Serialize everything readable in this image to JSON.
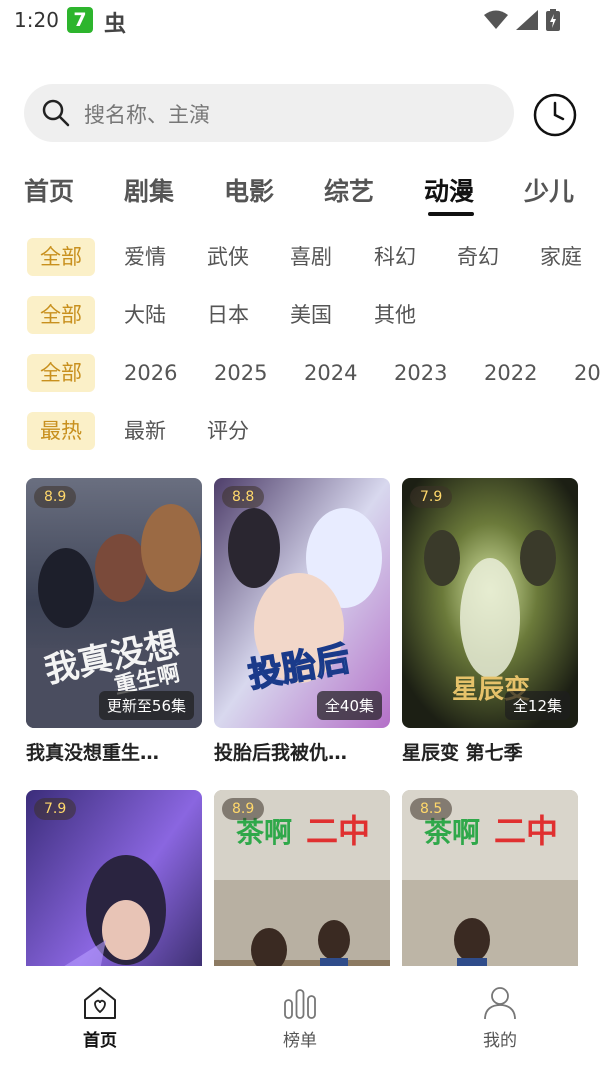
{
  "status": {
    "time": "1:20",
    "app_icon_glyph": "7",
    "app_icon_color": "#2db52d",
    "bug_glyph": "虫"
  },
  "search": {
    "placeholder": "搜名称、主演",
    "icon": "search-icon",
    "history_icon": "clock-icon"
  },
  "tabs": [
    {
      "label": "首页",
      "active": false
    },
    {
      "label": "剧集",
      "active": false
    },
    {
      "label": "电影",
      "active": false
    },
    {
      "label": "综艺",
      "active": false
    },
    {
      "label": "动漫",
      "active": true
    },
    {
      "label": "少儿",
      "active": false
    }
  ],
  "filters": {
    "genre": [
      "全部",
      "爱情",
      "武侠",
      "喜剧",
      "科幻",
      "奇幻",
      "家庭"
    ],
    "region": [
      "全部",
      "大陆",
      "日本",
      "美国",
      "其他"
    ],
    "year": [
      "全部",
      "2026",
      "2025",
      "2024",
      "2023",
      "2022",
      "20"
    ],
    "sort": [
      "最热",
      "最新",
      "评分"
    ]
  },
  "colors": {
    "accent": "#c8901e",
    "chip_bg": "#fbf0c8",
    "rating_text": "#ffd86b"
  },
  "cards": [
    {
      "title": "我真没想重生…",
      "rating": "8.9",
      "episode": "更新至56集"
    },
    {
      "title": "投胎后我被仇…",
      "rating": "8.8",
      "episode": "全40集"
    },
    {
      "title": "星辰变 第七季",
      "rating": "7.9",
      "episode": "全12集"
    },
    {
      "title": "",
      "rating": "7.9",
      "episode": ""
    },
    {
      "title": "",
      "rating": "8.9",
      "episode": ""
    },
    {
      "title": "",
      "rating": "8.5",
      "episode": ""
    }
  ],
  "nav": [
    {
      "label": "首页",
      "icon": "home-icon",
      "active": true
    },
    {
      "label": "榜单",
      "icon": "chart-icon",
      "active": false
    },
    {
      "label": "我的",
      "icon": "user-icon",
      "active": false
    }
  ]
}
